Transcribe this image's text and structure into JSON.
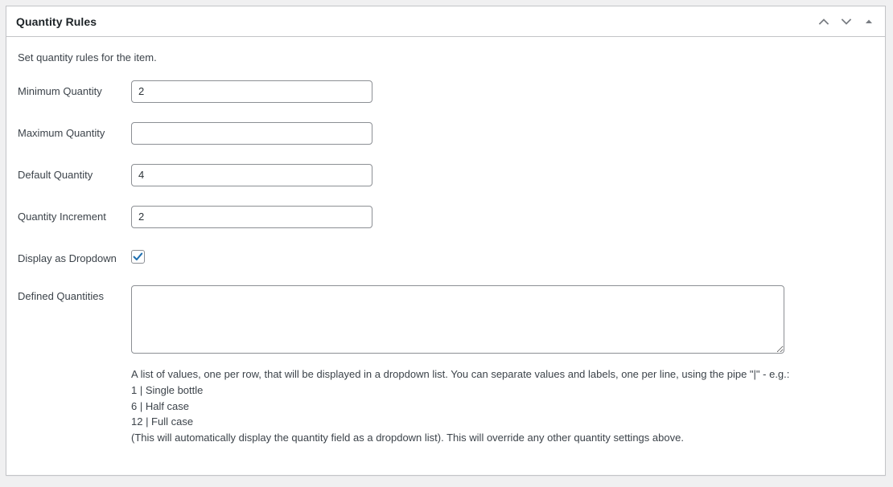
{
  "panel": {
    "title": "Quantity Rules",
    "intro": "Set quantity rules for the item.",
    "actions": [
      {
        "name": "move-up-button",
        "icon": "chevron-up-icon",
        "label": "Move up"
      },
      {
        "name": "move-down-button",
        "icon": "chevron-down-icon",
        "label": "Move down"
      },
      {
        "name": "toggle-panel-button",
        "icon": "triangle-up-icon",
        "label": "Toggle panel"
      }
    ]
  },
  "fields": {
    "minimum_quantity": {
      "label": "Minimum Quantity",
      "value": "2",
      "placeholder": ""
    },
    "maximum_quantity": {
      "label": "Maximum Quantity",
      "value": "",
      "placeholder": ""
    },
    "default_quantity": {
      "label": "Default Quantity",
      "value": "4",
      "placeholder": ""
    },
    "quantity_increment": {
      "label": "Quantity Increment",
      "value": "2",
      "placeholder": ""
    },
    "display_as_dropdown": {
      "label": "Display as Dropdown",
      "checked": true
    },
    "defined_quantities": {
      "label": "Defined Quantities",
      "value": "",
      "placeholder": ""
    }
  },
  "help": {
    "line1": "A list of values, one per row, that will be displayed in a dropdown list. You can separate values and labels, one per line, using the pipe \"|\" - e.g.:",
    "line2": "1 | Single bottle",
    "line3": "6 | Half case",
    "line4": "12 | Full case",
    "line5": "(This will automatically display the quantity field as a dropdown list). This will override any other quantity settings above."
  },
  "colors": {
    "page_background": "#f0f0f1",
    "panel_background": "#ffffff",
    "panel_border": "#c3c4c7",
    "title_text": "#1d2327",
    "body_text": "#3c434a",
    "input_border": "#8c8f94",
    "checkbox_accent": "#2271b1",
    "icon": "#787c82"
  }
}
